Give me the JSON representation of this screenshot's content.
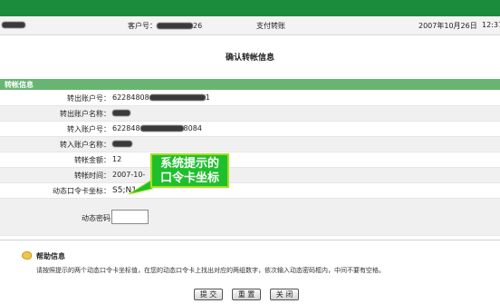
{
  "header": {
    "customer_no_label": "客户号：",
    "customer_no_tail": "26",
    "section": "支付转账",
    "date": "2007年10月26日",
    "time": "12:37"
  },
  "page_title": "确认转帐信息",
  "transfer_section": {
    "heading": "转帐信息",
    "rows": [
      {
        "label": "转出账户号：",
        "value_prefix": "62284808",
        "value_suffix": "1"
      },
      {
        "label": "转出账户名称：",
        "value_prefix": "",
        "value_suffix": ""
      },
      {
        "label": "转入账户号：",
        "value_prefix": "622848",
        "value_suffix": "8084"
      },
      {
        "label": "转入账户名称：",
        "value_prefix": "",
        "value_suffix": ""
      },
      {
        "label": "转帐金额：",
        "value_prefix": "12",
        "value_suffix": ""
      },
      {
        "label": "转帐时间：",
        "value_prefix": "2007-10-",
        "value_suffix": ""
      },
      {
        "label": "动态口令卡坐标：",
        "value_prefix": "S5;N1",
        "value_suffix": ""
      }
    ],
    "password_label": "动态密码",
    "password_value": ""
  },
  "annotation": {
    "line1": "系统提示的",
    "line2": "口令卡坐标"
  },
  "help": {
    "title": "帮助信息",
    "text": "请按照提示的两个动态口令卡坐标值，在您的动态口令卡上找出对应的两组数字，依次输入动态密码框内，中间不要有空格。"
  },
  "buttons": {
    "submit": "提 交",
    "reset": "重 置",
    "close": "关 闭"
  },
  "colors": {
    "topbar": "#1a8c3c",
    "section_head": "#68b573",
    "annotation": "#1fbf2c"
  }
}
